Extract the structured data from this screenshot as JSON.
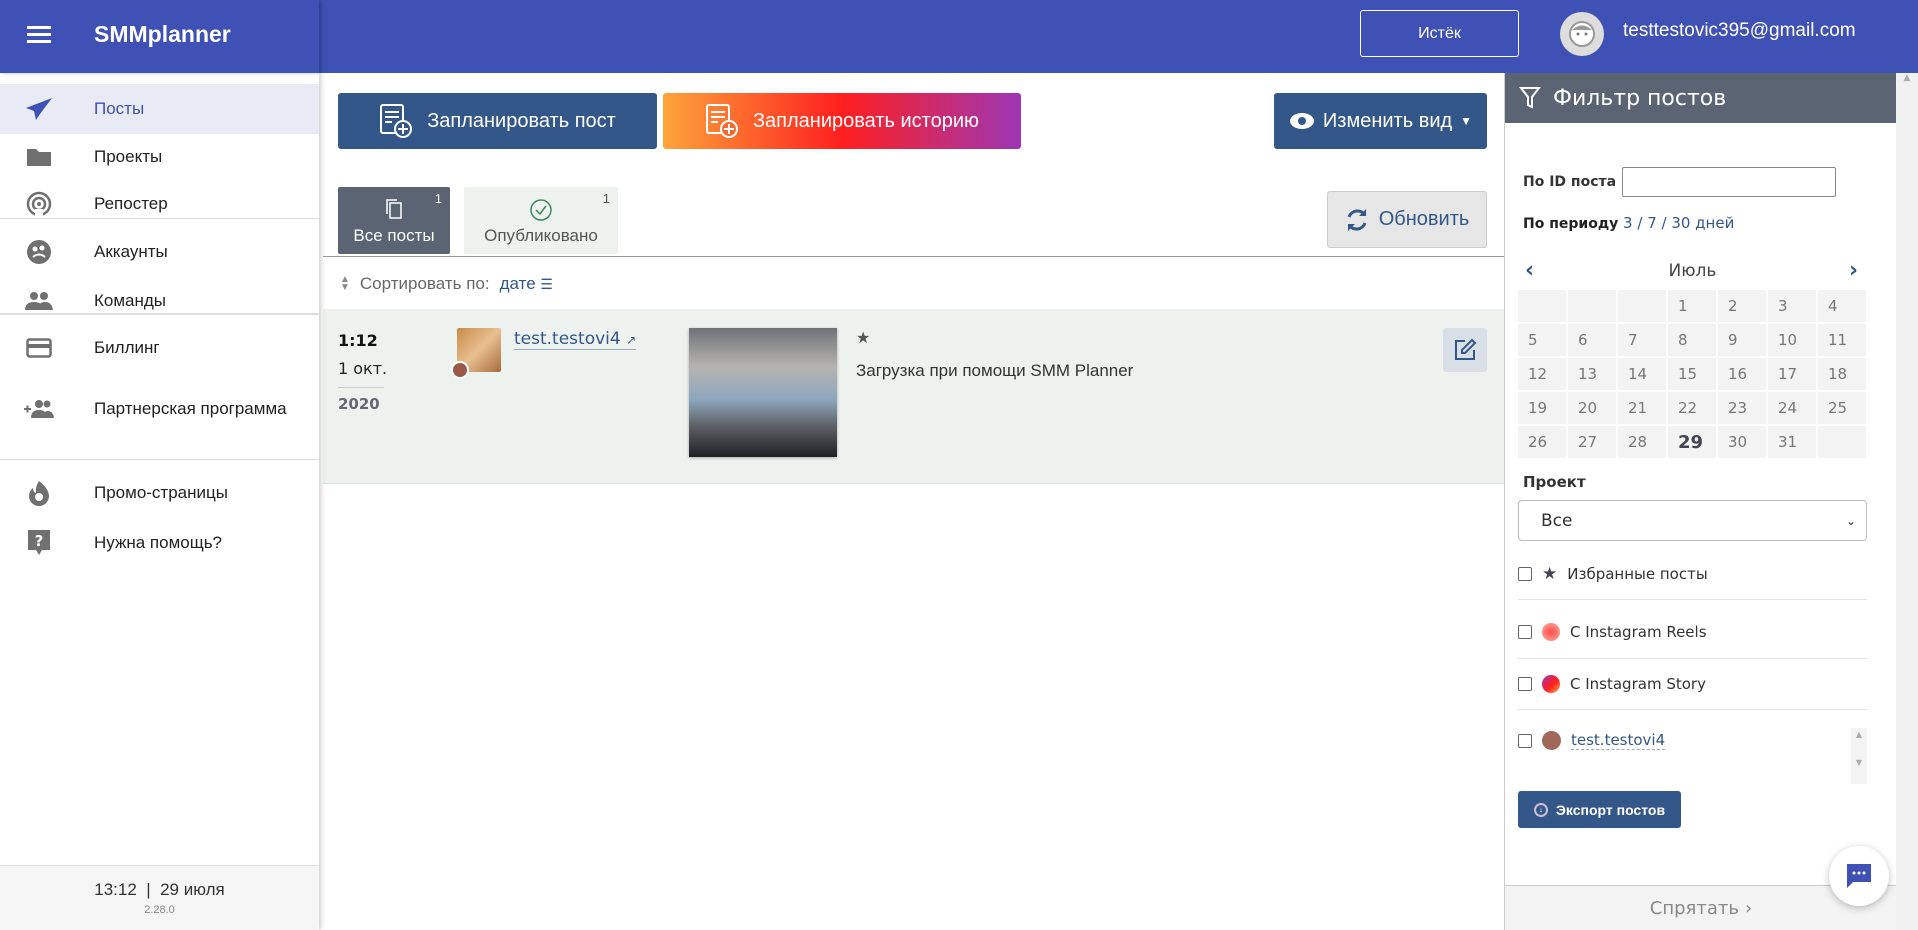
{
  "app": {
    "brand": "SMMplanner",
    "expired_label": "Истёк",
    "email": "testtestovic395@gmail.com"
  },
  "sidebar": {
    "items": [
      {
        "label": "Посты",
        "icon": "paper-plane-icon"
      },
      {
        "label": "Проекты",
        "icon": "folder-icon"
      },
      {
        "label": "Репостер",
        "icon": "broadcast-icon"
      },
      {
        "label": "Аккаунты",
        "icon": "accounts-icon"
      },
      {
        "label": "Команды",
        "icon": "people-icon"
      },
      {
        "label": "Биллинг",
        "icon": "credit-card-icon"
      },
      {
        "label": "Партнерская программа",
        "icon": "add-group-icon"
      },
      {
        "label": "Промо-страницы",
        "icon": "fire-icon"
      },
      {
        "label": "Нужна помощь?",
        "icon": "help-icon"
      }
    ],
    "footer_time": "13:12  |  29 июля",
    "version": "2.28.0"
  },
  "toolbar": {
    "schedule_post": "Запланировать пост",
    "schedule_story": "Запланировать историю",
    "change_view": "Изменить вид",
    "refresh": "Обновить"
  },
  "tabs": [
    {
      "label": "Все посты",
      "count": "1"
    },
    {
      "label": "Опубликовано",
      "count": "1"
    }
  ],
  "sort": {
    "label": "Сортировать по:",
    "value": "дате"
  },
  "posts": [
    {
      "time": "1:12",
      "date": "1 окт.",
      "year": "2020",
      "account": "test.testovi4",
      "star": "★",
      "text": "Загрузка при помощи SMM Planner"
    }
  ],
  "filter": {
    "title": "Фильтр постов",
    "id_label": "По ID поста",
    "id_value": "",
    "period_label": "По периоду",
    "period_3": "3",
    "period_7": "7",
    "period_30": "30 дней",
    "sep": " / ",
    "month": "Июль",
    "days": [
      "",
      "",
      "",
      "1",
      "2",
      "3",
      "4",
      "5",
      "6",
      "7",
      "8",
      "9",
      "10",
      "11",
      "12",
      "13",
      "14",
      "15",
      "16",
      "17",
      "18",
      "19",
      "20",
      "21",
      "22",
      "23",
      "24",
      "25",
      "26",
      "27",
      "28",
      "29",
      "30",
      "31",
      ""
    ],
    "today": "29",
    "project_label": "Проект",
    "project_value": "Все",
    "favorites": "Избранные посты",
    "reels": "С Instagram Reels",
    "story": "С Instagram Story",
    "account": "test.testovi4",
    "export": "Экспорт постов",
    "hide": "Спрятать"
  },
  "colors": {
    "header": "#3f51b5",
    "primary": "#34578a",
    "filter_head": "#5a6472"
  }
}
